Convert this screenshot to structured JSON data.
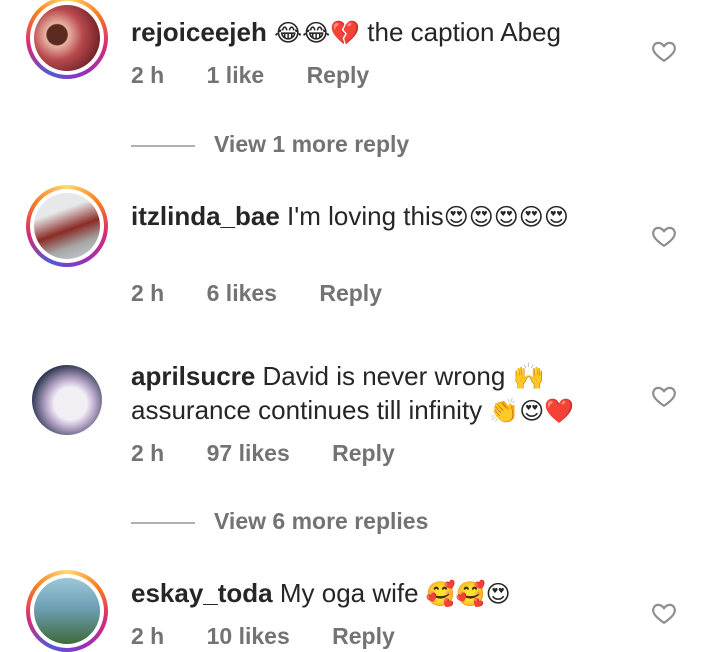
{
  "comments": [
    {
      "username": "rejoiceejeh",
      "emoji_prefix": "😂😂💔",
      "text": " the caption Abeg",
      "emoji_suffix": "",
      "time": "2 h",
      "likes": "1 like",
      "reply": "Reply",
      "avatar_colors": [
        "#6d1f25",
        "#e7b7a4"
      ]
    },
    {
      "username": "itzlinda_bae",
      "emoji_prefix": "",
      "text": " I'm loving this",
      "emoji_suffix": "😍😍😍😍😍",
      "time": "2 h",
      "likes": "6 likes",
      "reply": "Reply",
      "avatar_colors": [
        "#d9dcdf",
        "#6b2a25"
      ]
    },
    {
      "username": "aprilsucre",
      "emoji_prefix": "",
      "text": " David is never wrong 🙌 assurance continues till infinity ",
      "emoji_suffix": "👏😍❤️",
      "time": "2 h",
      "likes": "97 likes",
      "reply": "Reply",
      "avatar_colors": [
        "#1d2a44",
        "#e7e4ec"
      ]
    },
    {
      "username": "eskay_toda",
      "emoji_prefix": "",
      "text": " My oga wife ",
      "emoji_suffix": "🥰🥰😍",
      "time": "2 h",
      "likes": "10 likes",
      "reply": "Reply",
      "avatar_colors": [
        "#6f9fb5",
        "#3f6a3c"
      ]
    }
  ],
  "view_more": [
    "View 1 more reply",
    "View 6 more replies"
  ],
  "icons": {
    "like": "heart-outline-icon"
  },
  "colors": {
    "meta": "#737373",
    "text": "#262626"
  }
}
